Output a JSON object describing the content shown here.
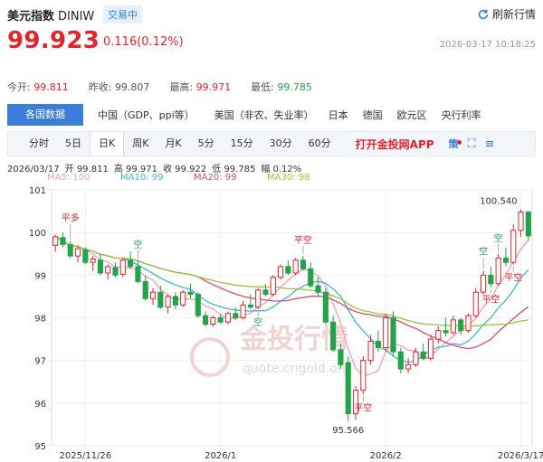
{
  "header": {
    "name": "美元指数",
    "code": "DINIW",
    "status": "交易中",
    "refresh_label": "刷新行情"
  },
  "quote": {
    "price": "99.923",
    "change": "0.116(0.12%)",
    "timestamp": "2026-03-17  10:18:25"
  },
  "stats": [
    {
      "label": "今开:",
      "value": "99.811",
      "color": "red"
    },
    {
      "label": "昨收:",
      "value": "99.807",
      "color": "plain"
    },
    {
      "label": "最高:",
      "value": "99.971",
      "color": "red"
    },
    {
      "label": "最低:",
      "value": "99.785",
      "color": "green"
    }
  ],
  "category_tabs": [
    "各国数据",
    "中国（GDP、ppi等）",
    "美国（非农、失业率）",
    "日本",
    "德国",
    "欧元区",
    "央行利率"
  ],
  "period_tabs": [
    "分时",
    "5日",
    "日K",
    "周K",
    "月K",
    "5分",
    "15分",
    "30分",
    "60分"
  ],
  "active_period": "日K",
  "app_label": "打开金投网APP",
  "ce_label": "策",
  "info_line": {
    "date": "2026/03/17",
    "open": "开 99.811",
    "high": "高 99.971",
    "close": "收 99.922",
    "low": "低 99.785",
    "range": "幅 0.12%"
  },
  "ma_labels": [
    {
      "text": "MA5: 100",
      "color": "#f0a0b8"
    },
    {
      "text": "MA10: 99",
      "color": "#3fb6d8"
    },
    {
      "text": "MA20: 99",
      "color": "#e0457a"
    },
    {
      "text": "MA30: 98",
      "color": "#9cc23a"
    }
  ],
  "watermark": {
    "brand": "金投行情",
    "url": "quote.cngold.org"
  },
  "chart_data": {
    "type": "candlestick",
    "ylim": [
      95,
      101
    ],
    "y_ticks": [
      "101",
      "100",
      "99",
      "98",
      "97",
      "96",
      "95"
    ],
    "x_ticks": [
      "2025/11/26",
      "2026/1",
      "2026/2",
      "2026/3/17"
    ],
    "annotations": {
      "max": "100.540",
      "min": "95.566",
      "markers": [
        "平多",
        "空",
        "平空",
        "空",
        "平空",
        "空",
        "平空",
        "空",
        "平空"
      ]
    },
    "colors": {
      "up": "#e3242b",
      "down": "#23a34a"
    },
    "candles": [
      [
        99.7,
        99.95,
        99.55,
        99.9
      ],
      [
        99.88,
        100.0,
        99.65,
        99.72
      ],
      [
        99.72,
        99.8,
        99.4,
        99.45
      ],
      [
        99.45,
        99.7,
        99.3,
        99.62
      ],
      [
        99.6,
        99.65,
        99.25,
        99.3
      ],
      [
        99.3,
        99.45,
        99.1,
        99.38
      ],
      [
        99.35,
        99.5,
        99.0,
        99.05
      ],
      [
        99.05,
        99.25,
        98.9,
        99.2
      ],
      [
        99.18,
        99.3,
        98.95,
        99.0
      ],
      [
        99.02,
        99.4,
        98.95,
        99.35
      ],
      [
        99.35,
        99.55,
        99.15,
        99.2
      ],
      [
        99.2,
        99.35,
        98.8,
        98.85
      ],
      [
        98.85,
        99.0,
        98.4,
        98.45
      ],
      [
        98.45,
        98.7,
        98.3,
        98.6
      ],
      [
        98.6,
        98.75,
        98.2,
        98.25
      ],
      [
        98.25,
        98.55,
        98.1,
        98.5
      ],
      [
        98.5,
        98.6,
        98.2,
        98.3
      ],
      [
        98.3,
        98.65,
        98.25,
        98.6
      ],
      [
        98.6,
        98.8,
        98.45,
        98.55
      ],
      [
        98.55,
        98.6,
        98.0,
        98.05
      ],
      [
        98.05,
        98.15,
        97.8,
        97.85
      ],
      [
        97.85,
        98.05,
        97.8,
        98.0
      ],
      [
        98.0,
        98.1,
        97.85,
        97.9
      ],
      [
        97.9,
        98.15,
        97.85,
        98.1
      ],
      [
        98.1,
        98.25,
        97.95,
        98.0
      ],
      [
        98.0,
        98.4,
        97.95,
        98.3
      ],
      [
        98.3,
        98.55,
        98.2,
        98.25
      ],
      [
        98.25,
        98.7,
        98.2,
        98.65
      ],
      [
        98.65,
        98.8,
        98.5,
        98.55
      ],
      [
        98.55,
        99.0,
        98.5,
        98.95
      ],
      [
        98.95,
        99.25,
        98.9,
        99.2
      ],
      [
        99.2,
        99.35,
        99.0,
        99.05
      ],
      [
        99.05,
        99.4,
        99.0,
        99.35
      ],
      [
        99.35,
        99.45,
        99.1,
        99.15
      ],
      [
        99.15,
        99.3,
        98.7,
        98.75
      ],
      [
        98.75,
        98.95,
        98.5,
        98.6
      ],
      [
        98.6,
        98.7,
        97.85,
        97.9
      ],
      [
        97.9,
        98.05,
        97.2,
        97.25
      ],
      [
        97.25,
        97.4,
        96.8,
        96.9
      ],
      [
        96.95,
        97.1,
        95.57,
        95.75
      ],
      [
        95.75,
        96.4,
        95.6,
        96.3
      ],
      [
        96.3,
        97.1,
        96.2,
        97.0
      ],
      [
        97.0,
        97.6,
        96.9,
        97.45
      ],
      [
        97.45,
        97.7,
        97.2,
        97.3
      ],
      [
        97.3,
        98.1,
        97.2,
        98.0
      ],
      [
        98.0,
        98.15,
        97.1,
        97.2
      ],
      [
        97.2,
        97.3,
        96.7,
        96.8
      ],
      [
        96.8,
        97.05,
        96.7,
        96.9
      ],
      [
        96.9,
        97.3,
        96.85,
        97.2
      ],
      [
        97.2,
        97.4,
        97.0,
        97.05
      ],
      [
        97.05,
        97.6,
        97.0,
        97.5
      ],
      [
        97.5,
        97.8,
        97.4,
        97.7
      ],
      [
        97.7,
        98.0,
        97.55,
        97.65
      ],
      [
        97.65,
        98.05,
        97.6,
        97.95
      ],
      [
        97.95,
        98.0,
        97.6,
        97.7
      ],
      [
        97.7,
        98.1,
        97.65,
        98.05
      ],
      [
        98.05,
        98.7,
        98.0,
        98.6
      ],
      [
        98.6,
        99.1,
        98.55,
        99.0
      ],
      [
        99.0,
        99.2,
        98.7,
        98.8
      ],
      [
        98.8,
        99.5,
        98.75,
        99.4
      ],
      [
        99.4,
        99.65,
        99.2,
        99.3
      ],
      [
        99.3,
        100.2,
        99.25,
        100.05
      ],
      [
        100.05,
        100.54,
        99.9,
        100.48
      ],
      [
        100.48,
        100.5,
        99.8,
        99.92
      ]
    ]
  }
}
